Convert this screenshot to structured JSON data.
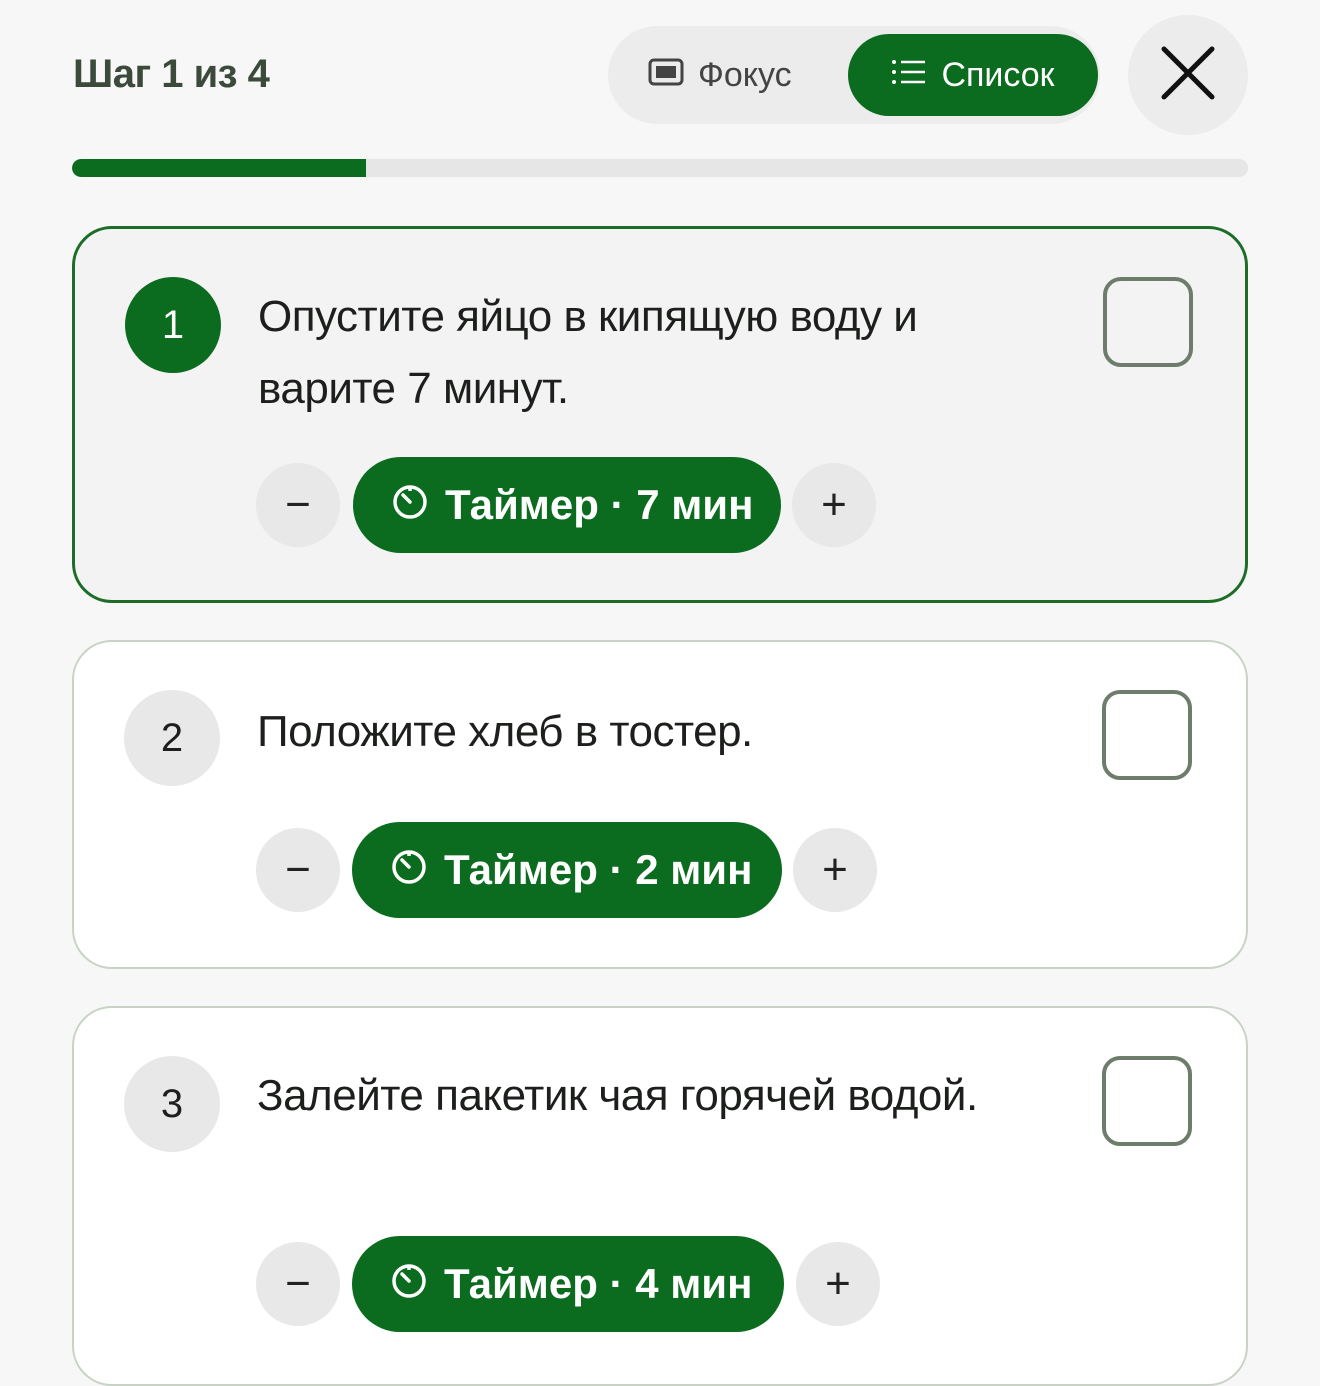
{
  "header": {
    "step_label": "Шаг 1 из 4",
    "view_toggle": {
      "focus_label": "Фокус",
      "list_label": "Список",
      "selected": "Список"
    },
    "close_icon": "close-icon"
  },
  "progress": {
    "current": 1,
    "total": 4,
    "fraction": 0.25
  },
  "steps": [
    {
      "number": "1",
      "text": "Опустите яйцо в кипящую воду и варите 7 минут.",
      "timer_label": "Таймер · 7 мин",
      "minus": "−",
      "plus": "+",
      "active": true,
      "checked": false
    },
    {
      "number": "2",
      "text": "Положите хлеб в тостер.",
      "timer_label": "Таймер · 2 мин",
      "minus": "−",
      "plus": "+",
      "active": false,
      "checked": false
    },
    {
      "number": "3",
      "text": "Залейте пакетик чая горячей водой.",
      "timer_label": "Таймер · 4 мин",
      "minus": "−",
      "plus": "+",
      "active": false,
      "checked": false
    }
  ],
  "colors": {
    "accent": "#0b6b1e",
    "active_border": "#1d6d29",
    "background": "#f7f7f7",
    "chip": "#e8e8e8"
  }
}
